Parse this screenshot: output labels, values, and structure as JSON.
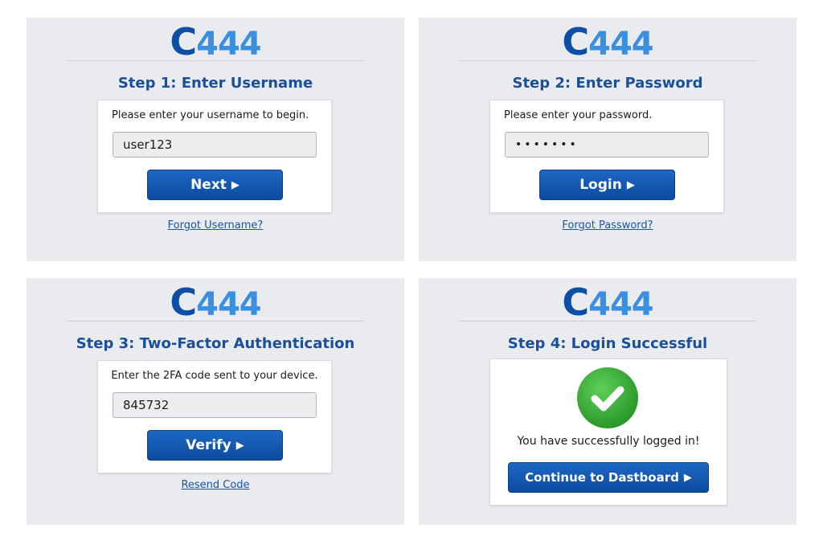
{
  "logo": {
    "letter": "C",
    "number": "444"
  },
  "colors": {
    "brand": "#0d4fa6",
    "brand_light": "#3a8fe0",
    "button": "#1559b0",
    "success": "#3bb13a",
    "panel_bg": "#e9ebef"
  },
  "icons": {
    "button_arrow": "play-triangle-icon",
    "success": "check-circle-icon"
  },
  "step1": {
    "title": "Step 1: Enter Username",
    "prompt": "Please enter your username to begin.",
    "username_value": "user123",
    "button_label": "Next",
    "link": "Forgot Username?"
  },
  "step2": {
    "title": "Step 2: Enter Password",
    "prompt": "Please enter your password.",
    "password_value": "•••••••",
    "button_label": "Login",
    "link": "Forgot Password?"
  },
  "step3": {
    "title": "Step 3: Two-Factor Authentication",
    "prompt": "Enter the 2FA code sent to your device.",
    "code_value": "845732",
    "button_label": "Verify",
    "link": "Resend Code"
  },
  "step4": {
    "title": "Step 4: Login Successful",
    "message": "You have successfully logged in!",
    "button_label": "Continue to Dastboard"
  }
}
